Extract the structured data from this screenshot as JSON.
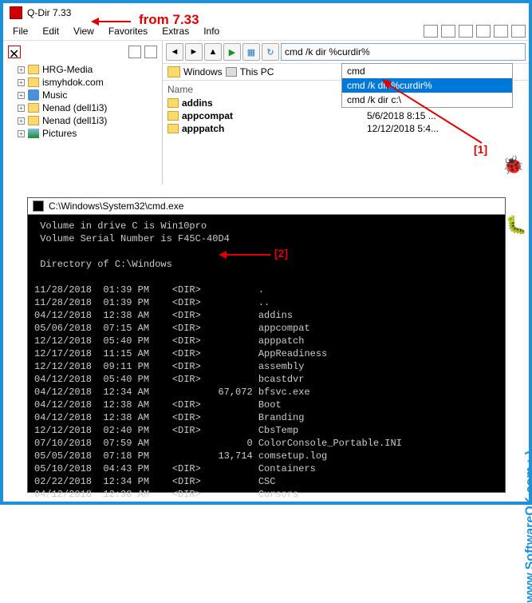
{
  "annotations": {
    "from": "from 7.33",
    "ref1": "[1]",
    "ref2": "[2]"
  },
  "titlebar": {
    "title": "Q-Dir 7.33"
  },
  "menu": {
    "file": "File",
    "edit": "Edit",
    "view": "View",
    "favorites": "Favorites",
    "extras": "Extras",
    "info": "Info"
  },
  "tree": {
    "items": [
      {
        "label": "HRG-Media"
      },
      {
        "label": "ismyhdok.com"
      },
      {
        "label": "Music"
      },
      {
        "label": "Nenad (dell1i3)"
      },
      {
        "label": "Nenad (dell1i3)"
      },
      {
        "label": "Pictures"
      }
    ]
  },
  "address": {
    "value": "cmd /k dir %curdir%"
  },
  "dropdown": {
    "items": [
      {
        "label": "cmd",
        "selected": false
      },
      {
        "label": "cmd /k dir %curdir%",
        "selected": true
      },
      {
        "label": "cmd /k dir c:\\",
        "selected": false
      }
    ]
  },
  "breadcrumb": {
    "folder": "Windows",
    "pc": "This PC"
  },
  "filelist": {
    "header_name": "Name",
    "rows": [
      {
        "name": "addins",
        "date": ""
      },
      {
        "name": "appcompat",
        "date": "5/6/2018 8:15 ..."
      },
      {
        "name": "apppatch",
        "date": "12/12/2018 5:4..."
      }
    ]
  },
  "cmd": {
    "title": "C:\\Windows\\System32\\cmd.exe",
    "lines": [
      " Volume in drive C is Win10pro",
      " Volume Serial Number is F45C-40D4",
      "",
      " Directory of C:\\Windows",
      "",
      "11/28/2018  01:39 PM    <DIR>          .",
      "11/28/2018  01:39 PM    <DIR>          ..",
      "04/12/2018  12:38 AM    <DIR>          addins",
      "05/06/2018  07:15 AM    <DIR>          appcompat",
      "12/12/2018  05:40 PM    <DIR>          apppatch",
      "12/17/2018  11:15 AM    <DIR>          AppReadiness",
      "12/12/2018  09:11 PM    <DIR>          assembly",
      "04/12/2018  05:40 PM    <DIR>          bcastdvr",
      "04/12/2018  12:34 AM            67,072 bfsvc.exe",
      "04/12/2018  12:38 AM    <DIR>          Boot",
      "04/12/2018  12:38 AM    <DIR>          Branding",
      "12/12/2018  02:40 PM    <DIR>          CbsTemp",
      "07/10/2018  07:59 AM                 0 ColorConsole_Portable.INI",
      "05/05/2018  07:18 PM            13,714 comsetup.log",
      "05/10/2018  04:43 PM    <DIR>          Containers",
      "02/22/2018  12:34 PM    <DIR>          CSC",
      "04/12/2018  12:38 AM    <DIR>          Cursors"
    ]
  },
  "watermark": "www.SoftwareOK.com  :-)"
}
